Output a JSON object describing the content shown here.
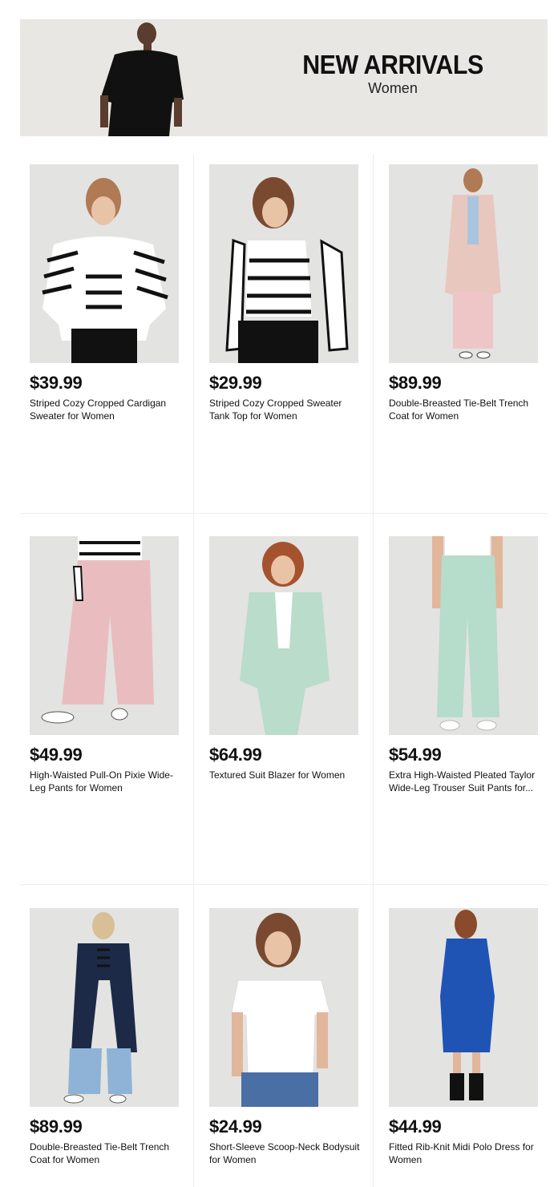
{
  "banner": {
    "title": "NEW ARRIVALS",
    "subtitle": "Women"
  },
  "products": [
    {
      "price": "$39.99",
      "name": "Striped Cozy Cropped Cardigan Sweater for Women",
      "image": "striped-cardigan"
    },
    {
      "price": "$29.99",
      "name": "Striped Cozy Cropped Sweater Tank Top for Women",
      "image": "striped-tank"
    },
    {
      "price": "$89.99",
      "name": "Double-Breasted Tie-Belt Trench Coat for Women",
      "image": "pink-trench"
    },
    {
      "price": "$49.99",
      "name": "High-Waisted Pull-On Pixie Wide-Leg Pants for Women",
      "image": "pink-pants"
    },
    {
      "price": "$64.99",
      "name": "Textured Suit Blazer for Women",
      "image": "mint-blazer"
    },
    {
      "price": "$54.99",
      "name": "Extra High-Waisted Pleated Taylor Wide-Leg Trouser Suit Pants for...",
      "image": "mint-trousers"
    },
    {
      "price": "$89.99",
      "name": "Double-Breasted Tie-Belt Trench Coat for Women",
      "image": "navy-trench"
    },
    {
      "price": "$24.99",
      "name": "Short-Sleeve Scoop-Neck Bodysuit for Women",
      "image": "white-bodysuit"
    },
    {
      "price": "$44.99",
      "name": "Fitted Rib-Knit Midi Polo Dress for Women",
      "image": "blue-polo-dress"
    }
  ],
  "colors": {
    "background": "#ffffff",
    "banner": "#e9e7e4",
    "photo": "#e3e3e1",
    "text": "#111111"
  }
}
